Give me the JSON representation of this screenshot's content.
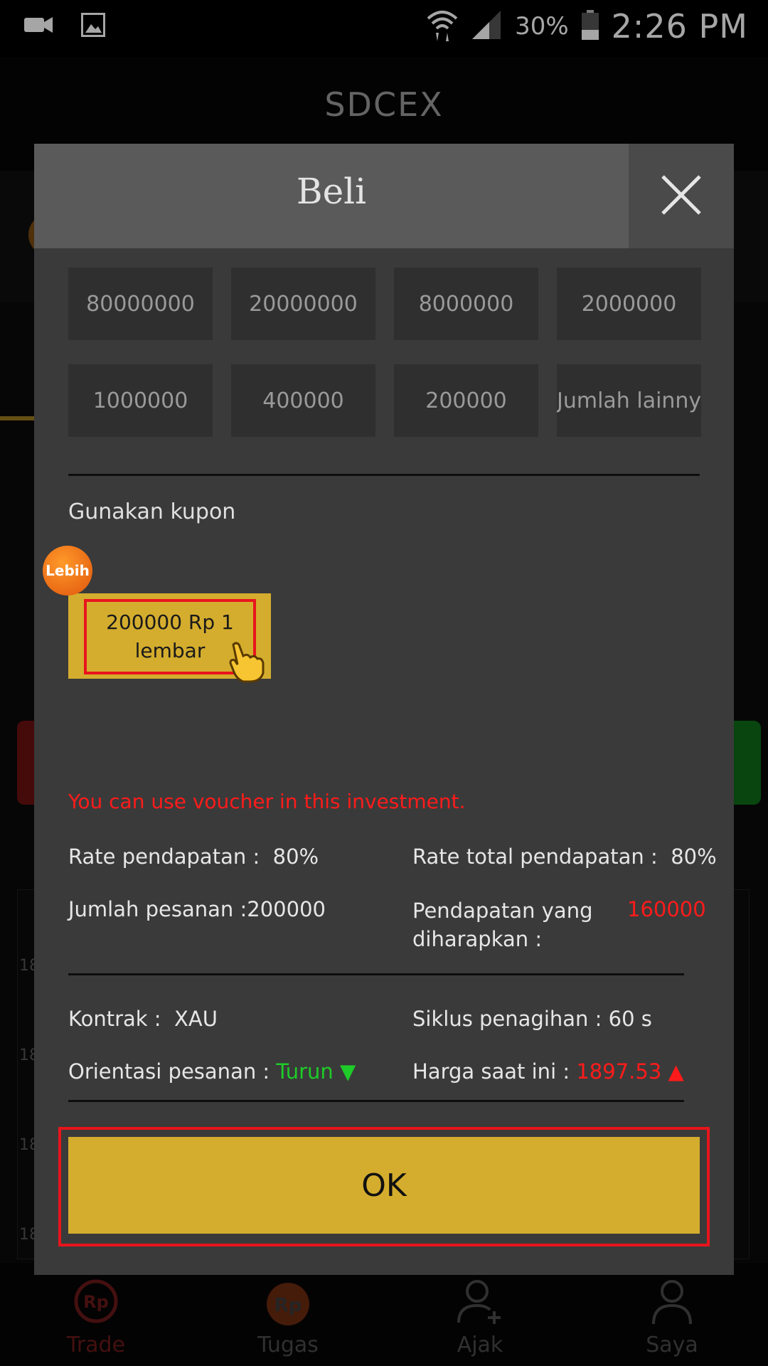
{
  "status_bar": {
    "battery_pct": "30%",
    "time": "2:26 PM"
  },
  "app": {
    "title": "SDCEX"
  },
  "background": {
    "chart_label_1": "18",
    "chart_label_2": "18",
    "chart_label_3": "18",
    "chart_label_4": "18"
  },
  "bottom_nav": {
    "items": [
      {
        "label": "Trade",
        "icon": "rp-cycle-icon"
      },
      {
        "label": "Tugas",
        "icon": "rp-fire-icon"
      },
      {
        "label": "Ajak",
        "icon": "add-user-icon"
      },
      {
        "label": "Saya",
        "icon": "user-icon"
      }
    ]
  },
  "modal": {
    "title": "Beli",
    "amounts": [
      "80000000",
      "20000000",
      "8000000",
      "2000000",
      "1000000",
      "400000",
      "200000",
      "Jumlah lainny"
    ],
    "coupon_label": "Gunakan kupon",
    "coupon_badge": "Lebih",
    "coupon_text": "200000 Rp 1 lembar",
    "voucher_message": "You can use voucher in this investment.",
    "rate_label": "Rate pendapatan :",
    "rate_value": "80%",
    "rate_total_label": "Rate total pendapatan :",
    "rate_total_value": "80%",
    "order_amount_label": "Jumlah pesanan :",
    "order_amount_value": "200000",
    "expected_income_label": "Pendapatan yang diharapkan :",
    "expected_income_value": "160000",
    "contract_label": "Kontrak :",
    "contract_value": "XAU",
    "billing_cycle_label": "Siklus penagihan :",
    "billing_cycle_value": "60 s",
    "orientation_label": "Orientasi pesanan :",
    "orientation_value": "Turun",
    "orientation_arrow": "▼",
    "current_price_label": "Harga saat ini :",
    "current_price_value": "1897.53",
    "current_price_arrow": "▲",
    "ok_label": "OK"
  },
  "colors": {
    "accent_gold": "#d4ad2e",
    "alert_red": "#ff1b1b",
    "down_green": "#1ecb28",
    "highlight_red": "#e8151c"
  }
}
